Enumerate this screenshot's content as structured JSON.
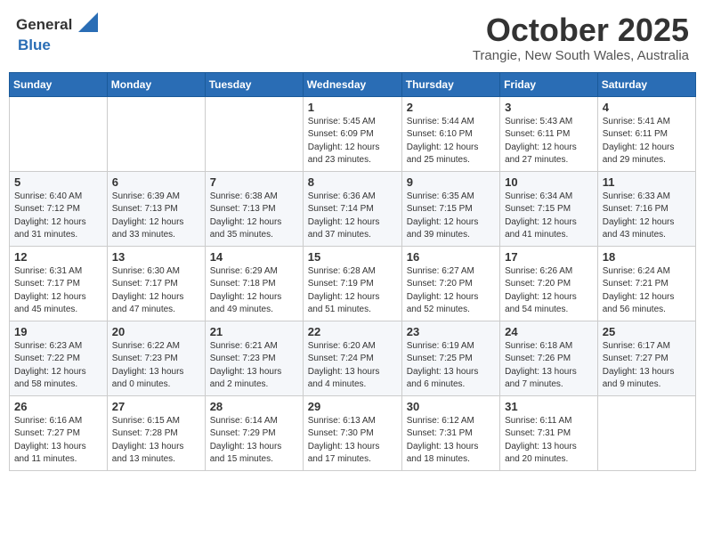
{
  "header": {
    "logo_general": "General",
    "logo_blue": "Blue",
    "month": "October 2025",
    "location": "Trangie, New South Wales, Australia"
  },
  "days_of_week": [
    "Sunday",
    "Monday",
    "Tuesday",
    "Wednesday",
    "Thursday",
    "Friday",
    "Saturday"
  ],
  "weeks": [
    [
      {
        "day": "",
        "info": ""
      },
      {
        "day": "",
        "info": ""
      },
      {
        "day": "",
        "info": ""
      },
      {
        "day": "1",
        "info": "Sunrise: 5:45 AM\nSunset: 6:09 PM\nDaylight: 12 hours\nand 23 minutes."
      },
      {
        "day": "2",
        "info": "Sunrise: 5:44 AM\nSunset: 6:10 PM\nDaylight: 12 hours\nand 25 minutes."
      },
      {
        "day": "3",
        "info": "Sunrise: 5:43 AM\nSunset: 6:11 PM\nDaylight: 12 hours\nand 27 minutes."
      },
      {
        "day": "4",
        "info": "Sunrise: 5:41 AM\nSunset: 6:11 PM\nDaylight: 12 hours\nand 29 minutes."
      }
    ],
    [
      {
        "day": "5",
        "info": "Sunrise: 6:40 AM\nSunset: 7:12 PM\nDaylight: 12 hours\nand 31 minutes."
      },
      {
        "day": "6",
        "info": "Sunrise: 6:39 AM\nSunset: 7:13 PM\nDaylight: 12 hours\nand 33 minutes."
      },
      {
        "day": "7",
        "info": "Sunrise: 6:38 AM\nSunset: 7:13 PM\nDaylight: 12 hours\nand 35 minutes."
      },
      {
        "day": "8",
        "info": "Sunrise: 6:36 AM\nSunset: 7:14 PM\nDaylight: 12 hours\nand 37 minutes."
      },
      {
        "day": "9",
        "info": "Sunrise: 6:35 AM\nSunset: 7:15 PM\nDaylight: 12 hours\nand 39 minutes."
      },
      {
        "day": "10",
        "info": "Sunrise: 6:34 AM\nSunset: 7:15 PM\nDaylight: 12 hours\nand 41 minutes."
      },
      {
        "day": "11",
        "info": "Sunrise: 6:33 AM\nSunset: 7:16 PM\nDaylight: 12 hours\nand 43 minutes."
      }
    ],
    [
      {
        "day": "12",
        "info": "Sunrise: 6:31 AM\nSunset: 7:17 PM\nDaylight: 12 hours\nand 45 minutes."
      },
      {
        "day": "13",
        "info": "Sunrise: 6:30 AM\nSunset: 7:17 PM\nDaylight: 12 hours\nand 47 minutes."
      },
      {
        "day": "14",
        "info": "Sunrise: 6:29 AM\nSunset: 7:18 PM\nDaylight: 12 hours\nand 49 minutes."
      },
      {
        "day": "15",
        "info": "Sunrise: 6:28 AM\nSunset: 7:19 PM\nDaylight: 12 hours\nand 51 minutes."
      },
      {
        "day": "16",
        "info": "Sunrise: 6:27 AM\nSunset: 7:20 PM\nDaylight: 12 hours\nand 52 minutes."
      },
      {
        "day": "17",
        "info": "Sunrise: 6:26 AM\nSunset: 7:20 PM\nDaylight: 12 hours\nand 54 minutes."
      },
      {
        "day": "18",
        "info": "Sunrise: 6:24 AM\nSunset: 7:21 PM\nDaylight: 12 hours\nand 56 minutes."
      }
    ],
    [
      {
        "day": "19",
        "info": "Sunrise: 6:23 AM\nSunset: 7:22 PM\nDaylight: 12 hours\nand 58 minutes."
      },
      {
        "day": "20",
        "info": "Sunrise: 6:22 AM\nSunset: 7:23 PM\nDaylight: 13 hours\nand 0 minutes."
      },
      {
        "day": "21",
        "info": "Sunrise: 6:21 AM\nSunset: 7:23 PM\nDaylight: 13 hours\nand 2 minutes."
      },
      {
        "day": "22",
        "info": "Sunrise: 6:20 AM\nSunset: 7:24 PM\nDaylight: 13 hours\nand 4 minutes."
      },
      {
        "day": "23",
        "info": "Sunrise: 6:19 AM\nSunset: 7:25 PM\nDaylight: 13 hours\nand 6 minutes."
      },
      {
        "day": "24",
        "info": "Sunrise: 6:18 AM\nSunset: 7:26 PM\nDaylight: 13 hours\nand 7 minutes."
      },
      {
        "day": "25",
        "info": "Sunrise: 6:17 AM\nSunset: 7:27 PM\nDaylight: 13 hours\nand 9 minutes."
      }
    ],
    [
      {
        "day": "26",
        "info": "Sunrise: 6:16 AM\nSunset: 7:27 PM\nDaylight: 13 hours\nand 11 minutes."
      },
      {
        "day": "27",
        "info": "Sunrise: 6:15 AM\nSunset: 7:28 PM\nDaylight: 13 hours\nand 13 minutes."
      },
      {
        "day": "28",
        "info": "Sunrise: 6:14 AM\nSunset: 7:29 PM\nDaylight: 13 hours\nand 15 minutes."
      },
      {
        "day": "29",
        "info": "Sunrise: 6:13 AM\nSunset: 7:30 PM\nDaylight: 13 hours\nand 17 minutes."
      },
      {
        "day": "30",
        "info": "Sunrise: 6:12 AM\nSunset: 7:31 PM\nDaylight: 13 hours\nand 18 minutes."
      },
      {
        "day": "31",
        "info": "Sunrise: 6:11 AM\nSunset: 7:31 PM\nDaylight: 13 hours\nand 20 minutes."
      },
      {
        "day": "",
        "info": ""
      }
    ]
  ]
}
